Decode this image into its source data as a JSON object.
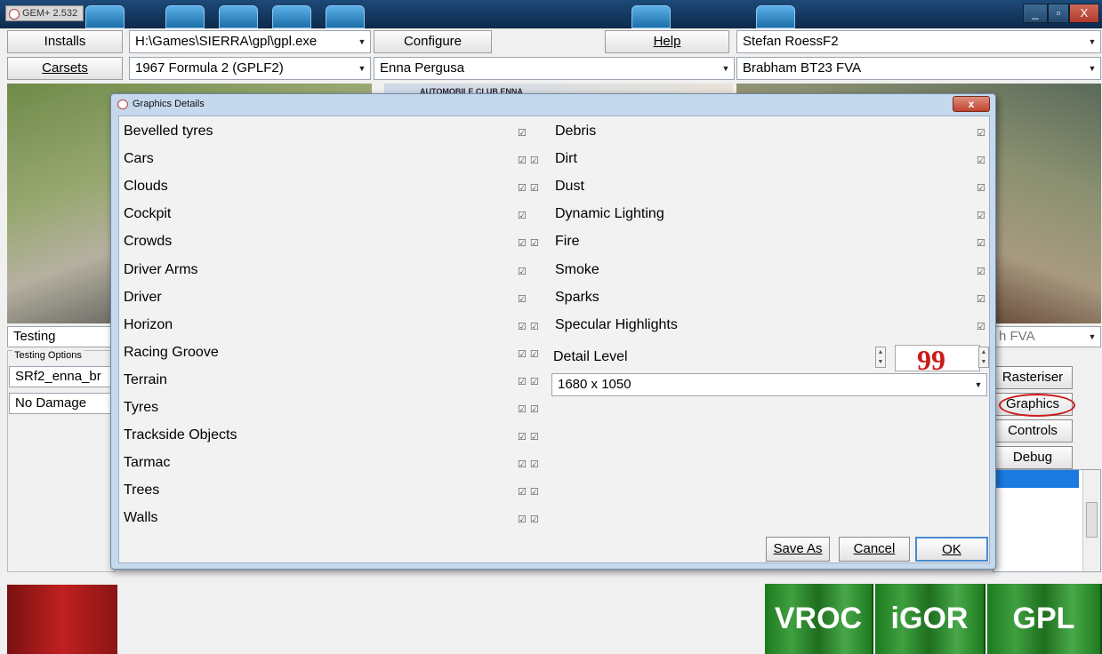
{
  "app": {
    "title": "GEM+ 2.532",
    "minimize": "_",
    "maximize": "▫",
    "close": "X"
  },
  "toolbar": {
    "installs_label": "Installs",
    "exe_path": "H:\\Games\\SIERRA\\gpl\\gpl.exe",
    "configure_label": "Configure",
    "help_label": "Help",
    "driver_name": "Stefan RoessF2",
    "carsets_label": "Carsets",
    "carset_value": "1967 Formula 2 (GPLF2)",
    "track_value": "Enna Pergusa",
    "car_value": "Brabham BT23 FVA"
  },
  "main": {
    "mode_value": "Testing",
    "testing_options_label": "Testing Options",
    "track_file_value": "SRf2_enna_br",
    "damage_value": "No Damage",
    "car_short_value": "h FVA",
    "rasteriser_label": "Rasteriser",
    "graphics_label": "Graphics",
    "controls_label": "Controls",
    "debug_label": "Debug",
    "poster_text": "AUTOMOBILE CLUB ENNA"
  },
  "dialog": {
    "title": "Graphics Details",
    "close": "x",
    "left_options": [
      {
        "label": "Bevelled tyres",
        "checks": "☑"
      },
      {
        "label": "Cars",
        "checks": "☑☑"
      },
      {
        "label": "Clouds",
        "checks": "☑☑"
      },
      {
        "label": "Cockpit",
        "checks": "☑"
      },
      {
        "label": "Crowds",
        "checks": "☑☑"
      },
      {
        "label": "Driver Arms",
        "checks": "☑"
      },
      {
        "label": "Driver",
        "checks": "☑"
      },
      {
        "label": "Horizon",
        "checks": "☑☑"
      },
      {
        "label": "Racing Groove",
        "checks": "☑☑"
      },
      {
        "label": "Terrain",
        "checks": "☑☑"
      },
      {
        "label": "Tyres",
        "checks": "☑☑"
      },
      {
        "label": "Trackside Objects",
        "checks": "☑☑"
      },
      {
        "label": "Tarmac",
        "checks": "☑☑"
      },
      {
        "label": "Trees",
        "checks": "☑☑"
      },
      {
        "label": "Walls",
        "checks": "☑☑"
      }
    ],
    "right_options": [
      {
        "label": "Debris",
        "checks": "☑"
      },
      {
        "label": "Dirt",
        "checks": "☑"
      },
      {
        "label": "Dust",
        "checks": "☑"
      },
      {
        "label": "Dynamic Lighting",
        "checks": "☑"
      },
      {
        "label": "Fire",
        "checks": "☑"
      },
      {
        "label": "Smoke",
        "checks": "☑"
      },
      {
        "label": "Sparks",
        "checks": "☑"
      },
      {
        "label": "Specular Highlights",
        "checks": "☑"
      }
    ],
    "detail_level_label": "Detail Level",
    "detail_level_value": "99",
    "resolution_value": "1680 x 1050",
    "save_as_label": "Save As",
    "cancel_label": "Cancel",
    "ok_label": "OK"
  },
  "logos": {
    "vroc": "VROC",
    "igor": "iGOR",
    "gpl": "GPL"
  },
  "colors": {
    "accent_red": "#cc1a1a",
    "selection_blue": "#1a7ae0",
    "green_logo": "#2f8f2f"
  }
}
